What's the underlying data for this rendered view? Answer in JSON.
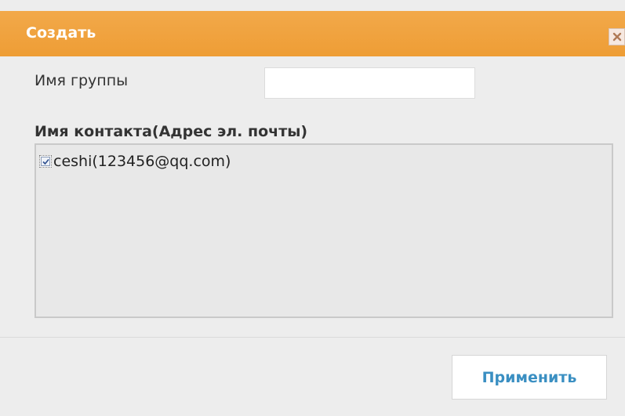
{
  "dialog": {
    "title": "Создать",
    "close_icon": "close-icon",
    "accent_color": "#ee9d35"
  },
  "group_name": {
    "label": "Имя группы",
    "value": "",
    "placeholder": ""
  },
  "contacts": {
    "label": "Имя контакта(Адрес эл. почты)",
    "items": [
      {
        "text": "ceshi(123456@qq.com)",
        "checked": true
      }
    ]
  },
  "footer": {
    "apply_label": "Применить",
    "apply_color": "#3a8fc2"
  }
}
